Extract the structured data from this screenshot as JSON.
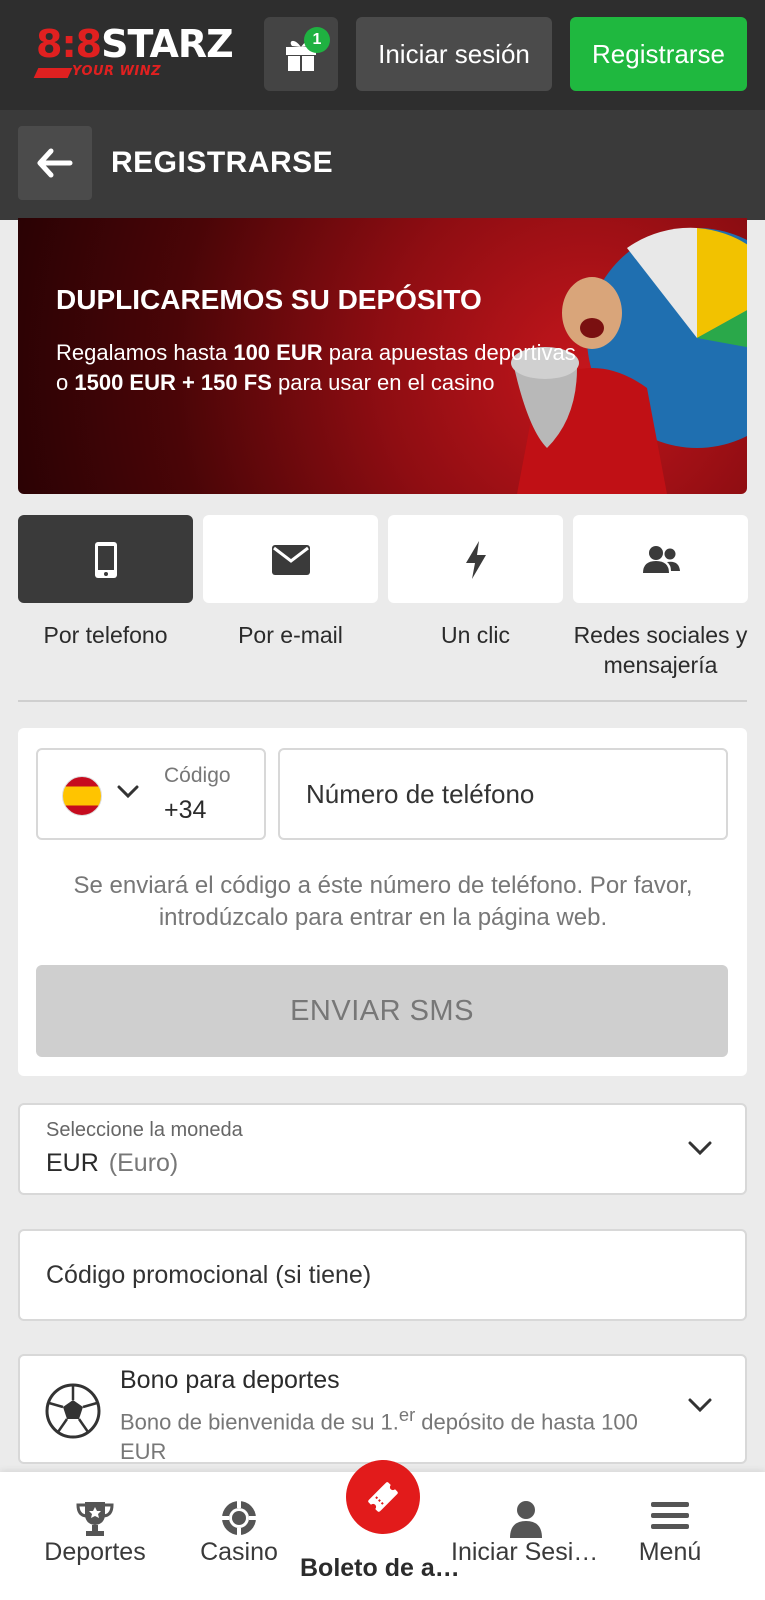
{
  "header": {
    "logo_text_left": "8",
    "logo_text_mid": "8",
    "logo_text_brand": "STARZ",
    "logo_tagline": "YOUR WINZ",
    "gift_badge": "1",
    "login_label": "Iniciar sesión",
    "register_label": "Registrarse"
  },
  "titlebar": {
    "title": "REGISTRARSE"
  },
  "banner": {
    "title": "DUPLICAREMOS SU DEPÓSITO",
    "line1_pre": "Regalamos hasta ",
    "line1_bold": "100 EUR",
    "line1_post": " para apuestas deportivas",
    "line2_pre": "o ",
    "line2_bold": "1500 EUR + 150 FS",
    "line2_post": " para usar en el casino"
  },
  "tabs": [
    {
      "label": "Por telefono",
      "icon": "phone-icon",
      "active": true
    },
    {
      "label": "Por e-mail",
      "icon": "envelope-icon",
      "active": false
    },
    {
      "label": "Un clic",
      "icon": "lightning-icon",
      "active": false
    },
    {
      "label": "Redes sociales y mensajería",
      "icon": "users-icon",
      "active": false
    }
  ],
  "phone_form": {
    "code_label": "Código",
    "code_value": "+34",
    "phone_placeholder": "Número de teléfono",
    "hint": "Se enviará el código a éste número de teléfono. Por favor, introdúzcalo para entrar en la página web.",
    "sms_button": "ENVIAR SMS"
  },
  "currency": {
    "label": "Seleccione la moneda",
    "code": "EUR",
    "name": "(Euro)"
  },
  "promo": {
    "placeholder": "Código promocional (si tiene)"
  },
  "bonus": {
    "title": "Bono para deportes",
    "subtitle_pre": "Bono de bienvenida de su 1.",
    "subtitle_sup": "er",
    "subtitle_post": " depósito de hasta 100 EUR"
  },
  "bottom_nav": [
    {
      "label": "Deportes",
      "icon": "trophy-icon"
    },
    {
      "label": "Casino",
      "icon": "casino-chip-icon"
    },
    {
      "label": "Boleto de apuestas",
      "icon": "ticket-icon"
    },
    {
      "label": "Iniciar Sesión",
      "icon": "user-icon"
    },
    {
      "label": "Menú",
      "icon": "hamburger-icon"
    }
  ],
  "colors": {
    "green": "#1fb83f",
    "red": "#e21b1b",
    "dark": "#2e2e2e"
  }
}
